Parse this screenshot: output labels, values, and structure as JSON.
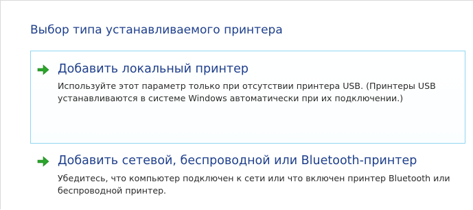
{
  "page": {
    "title": "Выбор типа устанавливаемого принтера"
  },
  "options": [
    {
      "icon": "green-arrow-icon",
      "title": "Добавить локальный принтер",
      "description": "Используйте этот параметр только при отсутствии принтера USB. (Принтеры USB устанавливаются в системе Windows автоматически при их подключении.)",
      "selected": true
    },
    {
      "icon": "green-arrow-icon",
      "title": "Добавить сетевой, беспроводной или Bluetooth-принтер",
      "description": "Убедитесь, что компьютер подключен к сети или что включен принтер Bluetooth или беспроводной принтер.",
      "selected": false
    }
  ],
  "colors": {
    "title": "#1e3f8c",
    "arrow": "#2aa52a",
    "selected_border": "#8fd6f2"
  }
}
